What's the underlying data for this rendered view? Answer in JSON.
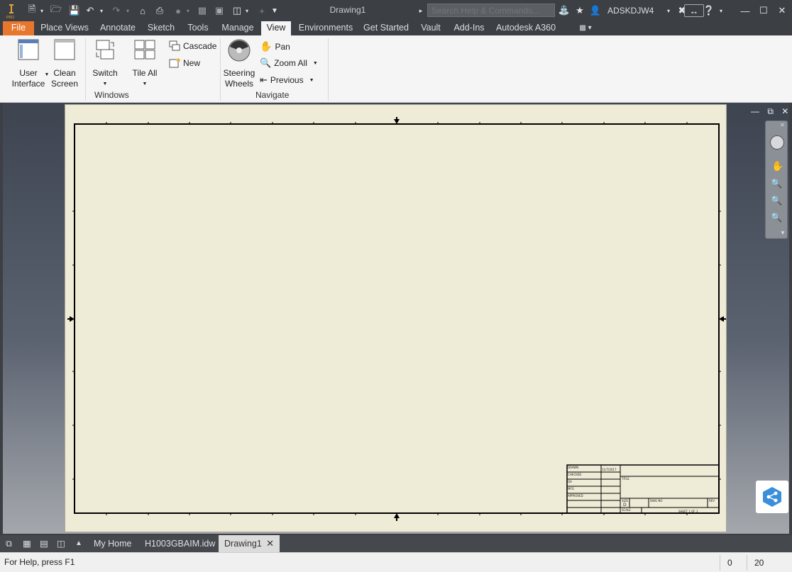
{
  "window": {
    "title": "Drawing1",
    "user": "ADSKDJW4",
    "search_placeholder": "Search Help & Commands..."
  },
  "menu_tabs": [
    "File",
    "Place Views",
    "Annotate",
    "Sketch",
    "Tools",
    "Manage",
    "View",
    "Environments",
    "Get Started",
    "Vault",
    "Add-Ins",
    "Autodesk A360"
  ],
  "ribbon": {
    "windows": {
      "title": "Windows",
      "user_interface_1": "User",
      "user_interface_2": "Interface",
      "clean_screen_1": "Clean",
      "clean_screen_2": "Screen",
      "switch": "Switch",
      "tile_all": "Tile All",
      "cascade": "Cascade",
      "new": "New"
    },
    "navigate": {
      "title": "Navigate",
      "steering_1": "Steering",
      "steering_2": "Wheels",
      "pan": "Pan",
      "zoom_all": "Zoom All",
      "previous": "Previous"
    }
  },
  "title_block": {
    "title": "TITLE",
    "size": "SIZE",
    "size_value": "D",
    "scale": "SCALE",
    "sheet": "SHEET 1  OF 1",
    "rev": "REV",
    "dwg_no": "DWG NO",
    "drawn": "DRAWN",
    "checked": "CHECKED",
    "approved": "APPROVED",
    "date": "11/7/2017",
    "qa": "QA",
    "mfg": "MFG"
  },
  "doc_tabs": [
    "My Home",
    "H1003GBAIM.idw",
    "Drawing1"
  ],
  "status": {
    "help": "For Help, press F1",
    "value1": "0",
    "value2": "20"
  },
  "colors": {
    "accent_file": "#e8772e",
    "sheet": "#eeebd6",
    "chrome": "#3c3f44"
  }
}
